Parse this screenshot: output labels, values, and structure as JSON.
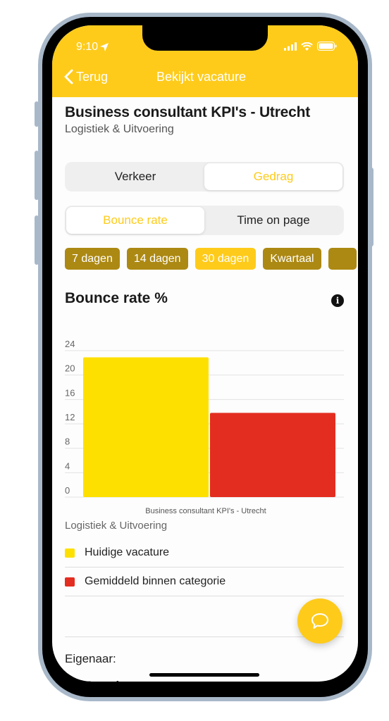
{
  "status_bar": {
    "time": "9:10",
    "location_icon": "location-arrow-icon",
    "signal_icon": "cellular-signal-icon",
    "wifi_icon": "wifi-icon",
    "battery_icon": "battery-icon"
  },
  "nav": {
    "back_label": "Terug",
    "title": "Bekijkt vacature"
  },
  "job": {
    "title": "Business consultant KPI's - Utrecht",
    "category": "Logistiek & Uitvoering"
  },
  "main_tabs": [
    {
      "label": "Verkeer",
      "active": false
    },
    {
      "label": "Gedrag",
      "active": true
    }
  ],
  "metric_tabs": [
    {
      "label": "Bounce rate",
      "active": true
    },
    {
      "label": "Time on page",
      "active": false
    }
  ],
  "period_pills": [
    {
      "label": "7 dagen",
      "active": false
    },
    {
      "label": "14 dagen",
      "active": false
    },
    {
      "label": "30 dagen",
      "active": true
    },
    {
      "label": "Kwartaal",
      "active": false
    },
    {
      "label": "",
      "active": false
    }
  ],
  "chart_section": {
    "title": "Bounce rate %",
    "info_icon": "info-icon"
  },
  "chart_data": {
    "type": "bar",
    "title": "Bounce rate %",
    "xlabel": "Business consultant KPI's - Utrecht",
    "ylabel": "",
    "ylim": [
      0,
      24
    ],
    "yticks": [
      0,
      4,
      8,
      12,
      16,
      20,
      24
    ],
    "grid": true,
    "categories": [
      "Business consultant KPI's - Utrecht"
    ],
    "series": [
      {
        "name": "Huidige vacature",
        "color": "#fee000",
        "values": [
          22.9
        ]
      },
      {
        "name": "Gemiddeld binnen categorie",
        "color": "#e32d20",
        "values": [
          13.8
        ]
      }
    ]
  },
  "legend": {
    "category": "Logistiek & Uitvoering",
    "items": [
      {
        "label": "Huidige vacature",
        "color": "#fee000"
      },
      {
        "label": "Gemiddeld binnen categorie",
        "color": "#e32d20"
      }
    ]
  },
  "owner": {
    "label": "Eigenaar:",
    "name": "Bernd"
  },
  "fab": {
    "icon": "chat-bubble-icon"
  },
  "colors": {
    "accent": "#fecb1b",
    "pill_inactive": "#ac8913"
  }
}
